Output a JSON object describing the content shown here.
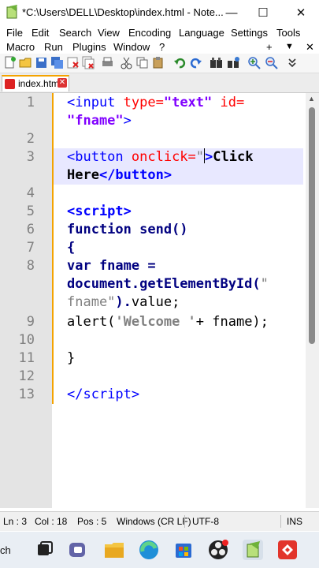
{
  "window": {
    "title": "*C:\\Users\\DELL\\Desktop\\index.html - Note...",
    "minimize": "—",
    "maximize": "☐",
    "close": "✕"
  },
  "menu": {
    "row1": [
      "File",
      "Edit",
      "Search",
      "View",
      "Encoding",
      "Language",
      "Settings",
      "Tools"
    ],
    "row2": [
      "Macro",
      "Run",
      "Plugins",
      "Window",
      "?"
    ],
    "plus": "+",
    "down": "▼",
    "close": "✕"
  },
  "tab": {
    "label": "index.html",
    "close": "✕"
  },
  "editor": {
    "line_numbers": [
      "1",
      "2",
      "3",
      "4",
      "5",
      "6",
      "7",
      "8",
      "9",
      "10",
      "11",
      "12",
      "13"
    ]
  },
  "status": {
    "ln": "Ln : 3",
    "col": "Col : 18",
    "pos": "Pos : 5",
    "eol": "Windows (CR LF)",
    "encoding": "UTF-8",
    "mode": "INS"
  },
  "taskbar": {
    "search": "ch"
  },
  "colors": {
    "accent": "#f4a300",
    "tag": "#0000ff",
    "attribute": "#ff0000",
    "value": "#8000ff",
    "keyword": "#000080"
  }
}
